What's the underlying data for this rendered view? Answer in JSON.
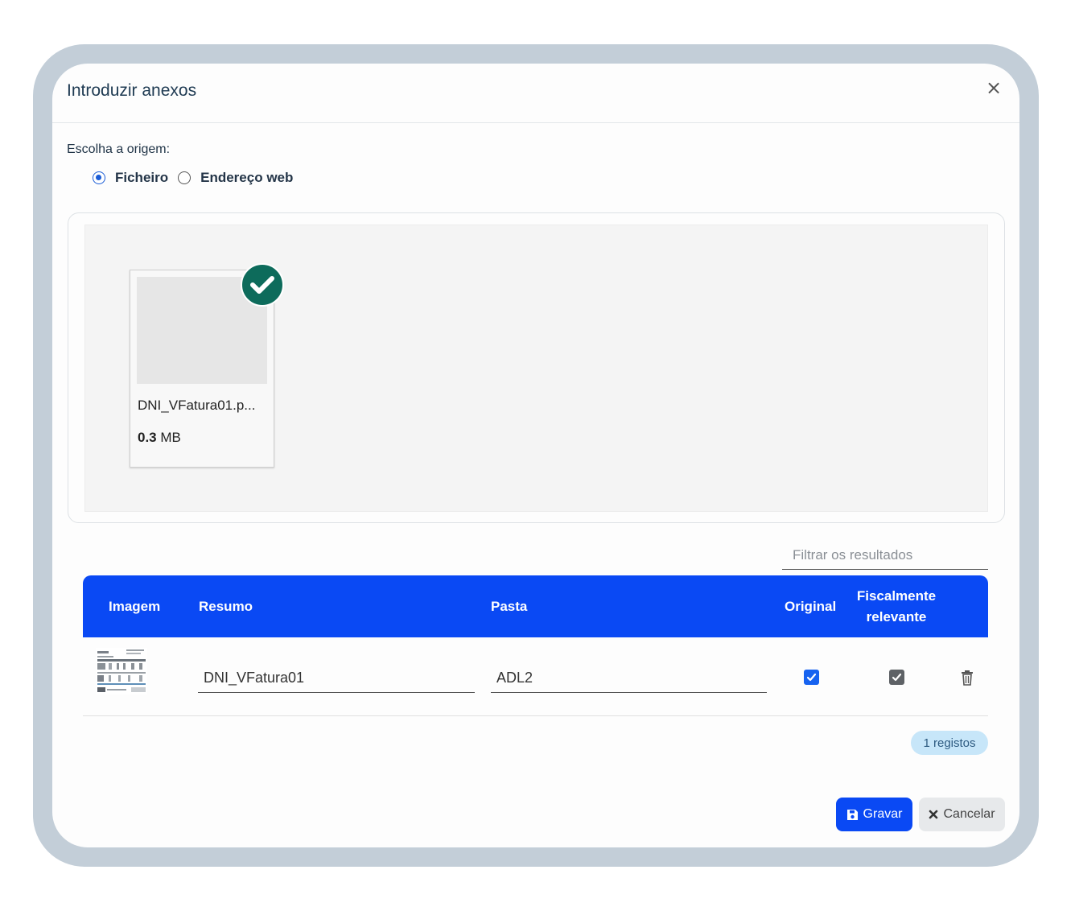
{
  "dialog": {
    "title": "Introduzir anexos",
    "close_icon": "×"
  },
  "origin": {
    "label": "Escolha a origem:",
    "options": [
      {
        "label": "Ficheiro",
        "selected": true
      },
      {
        "label": "Endereço web",
        "selected": false
      }
    ]
  },
  "upload": {
    "file_name": "DNI_VFatura01.p...",
    "size_value": "0.3",
    "size_unit": "MB",
    "status_icon": "check-circle-icon",
    "status_color": "#0d6b5b"
  },
  "filter": {
    "placeholder": "Filtrar os resultados"
  },
  "table": {
    "headers": {
      "imagem": "Imagem",
      "resumo": "Resumo",
      "pasta": "Pasta",
      "original": "Original",
      "fiscal_line1": "Fiscalmente",
      "fiscal_line2": "relevante"
    },
    "header_color": "#0a49f4",
    "rows": [
      {
        "resumo": "DNI_VFatura01",
        "pasta": "ADL2",
        "original": true,
        "fiscal": true
      }
    ],
    "count_label": "1 registos"
  },
  "actions": {
    "save_label": "Gravar",
    "cancel_label": "Cancelar"
  }
}
